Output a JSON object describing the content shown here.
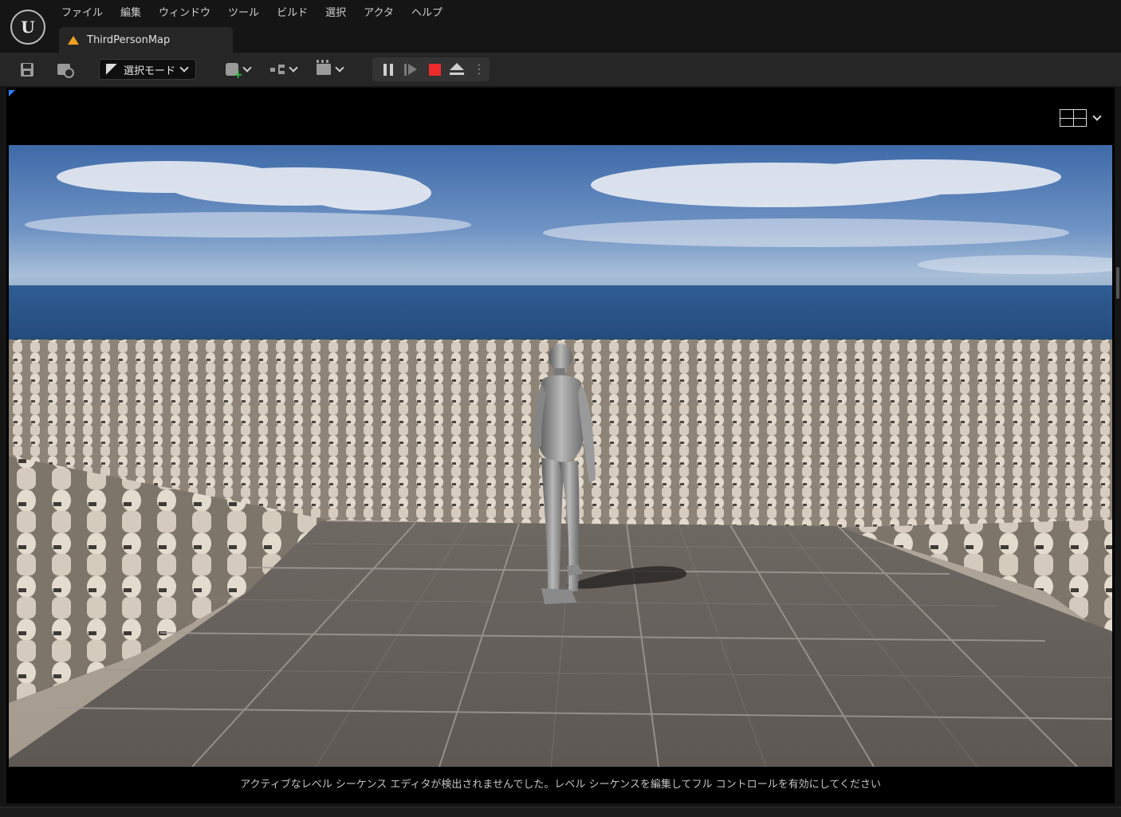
{
  "menu": [
    "ファイル",
    "編集",
    "ウィンドウ",
    "ツール",
    "ビルド",
    "選択",
    "アクタ",
    "ヘルプ"
  ],
  "tab": {
    "label": "ThirdPersonMap",
    "icon": "level-map-icon"
  },
  "toolbar": {
    "mode_label": "選択モード",
    "icons": [
      "save-icon",
      "content-browser-icon",
      "select-mode-icon",
      "add-actor-icon",
      "blueprint-icon",
      "cinematics-icon"
    ]
  },
  "play_controls": [
    "pause-icon",
    "step-frame-icon",
    "stop-icon",
    "eject-icon",
    "more-options-icon"
  ],
  "viewport": {
    "status_message": "アクティブなレベル シーケンス エディタが検出されませんでした。レベル シーケンスを編集してフル コントロールを有効にしてください"
  },
  "colors": {
    "background": "#151515",
    "toolbar": "#262626",
    "stop": "#ee2b2b",
    "accent_blue": "#2a7fff",
    "tab_icon": "#f0a020"
  }
}
